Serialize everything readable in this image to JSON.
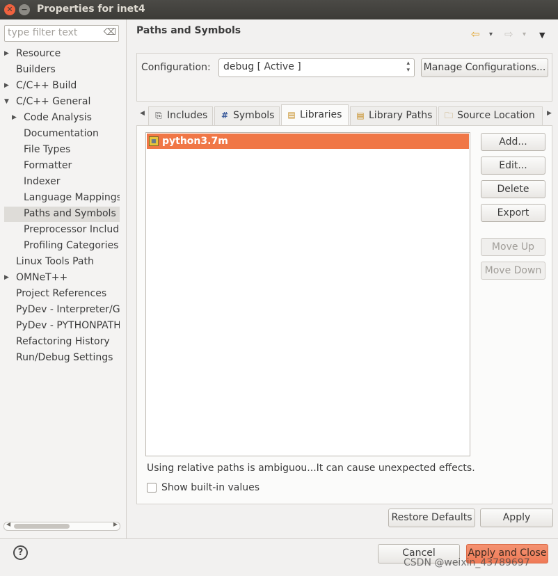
{
  "window": {
    "title": "Properties for inet4",
    "close_glyph": "✕",
    "min_glyph": "−"
  },
  "sidebar": {
    "filter_placeholder": "type filter text",
    "filter_clear_glyph": "⌫",
    "items": [
      {
        "label": "Resource",
        "expandable": true,
        "indent": 0
      },
      {
        "label": "Builders",
        "expandable": false,
        "indent": 0
      },
      {
        "label": "C/C++ Build",
        "expandable": true,
        "indent": 0
      },
      {
        "label": "C/C++ General",
        "expandable": true,
        "expanded": true,
        "indent": 0
      },
      {
        "label": "Code Analysis",
        "expandable": true,
        "indent": 1
      },
      {
        "label": "Documentation",
        "expandable": false,
        "indent": 1
      },
      {
        "label": "File Types",
        "expandable": false,
        "indent": 1
      },
      {
        "label": "Formatter",
        "expandable": false,
        "indent": 1
      },
      {
        "label": "Indexer",
        "expandable": false,
        "indent": 1
      },
      {
        "label": "Language Mappings",
        "expandable": false,
        "indent": 1
      },
      {
        "label": "Paths and Symbols",
        "expandable": false,
        "indent": 1,
        "selected": true
      },
      {
        "label": "Preprocessor Include Paths, Macros etc.",
        "expandable": false,
        "indent": 1
      },
      {
        "label": "Profiling Categories",
        "expandable": false,
        "indent": 1
      },
      {
        "label": "Linux Tools Path",
        "expandable": false,
        "indent": 0
      },
      {
        "label": "OMNeT++",
        "expandable": true,
        "indent": 0
      },
      {
        "label": "Project References",
        "expandable": false,
        "indent": 0
      },
      {
        "label": "PyDev - Interpreter/Grammar",
        "expandable": false,
        "indent": 0
      },
      {
        "label": "PyDev - PYTHONPATH",
        "expandable": false,
        "indent": 0
      },
      {
        "label": "Refactoring History",
        "expandable": false,
        "indent": 0
      },
      {
        "label": "Run/Debug Settings",
        "expandable": false,
        "indent": 0
      }
    ]
  },
  "page": {
    "title": "Paths and Symbols",
    "nav": {
      "back_glyph": "⇦",
      "forward_glyph": "⇨",
      "dropdown_glyph": "▾",
      "menu_glyph": "▼"
    }
  },
  "configuration": {
    "label": "Configuration:",
    "value": "debug  [ Active ]",
    "manage_button": "Manage Configurations..."
  },
  "tabs": [
    {
      "label": "Includes",
      "icon": "includes-icon",
      "glyph": "⎘",
      "active": false
    },
    {
      "label": "Symbols",
      "icon": "hash-icon",
      "glyph": "#",
      "active": false
    },
    {
      "label": "Libraries",
      "icon": "books-icon",
      "glyph": "▤",
      "active": true
    },
    {
      "label": "Library Paths",
      "icon": "library-paths-icon",
      "glyph": "▤",
      "active": false
    },
    {
      "label": "Source Location",
      "icon": "folder-icon",
      "glyph": "🗀",
      "active": false
    }
  ],
  "libraries": {
    "items": [
      {
        "label": "python3.7m",
        "selected": true
      }
    ],
    "buttons": {
      "add": "Add...",
      "edit": "Edit...",
      "delete": "Delete",
      "export": "Export",
      "move_up": "Move Up",
      "move_down": "Move Down"
    },
    "note": "Using relative paths is ambiguou...It can cause unexpected effects.",
    "show_builtin": {
      "label": "Show built-in values",
      "checked": false
    }
  },
  "footer": {
    "restore_defaults": "Restore Defaults",
    "apply": "Apply",
    "cancel": "Cancel",
    "apply_close": "Apply and Close",
    "help_glyph": "?"
  },
  "watermark": "CSDN @weixin_43789697",
  "colors": {
    "selection": "#f07746",
    "titlebar": "#3c3b37",
    "close_button": "#f0623f"
  }
}
